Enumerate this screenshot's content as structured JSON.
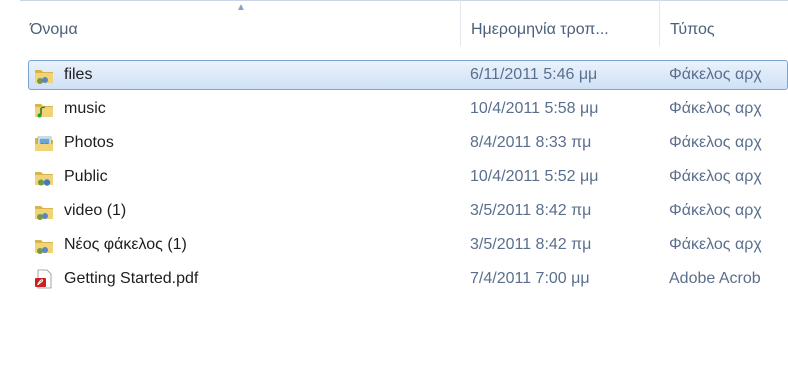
{
  "columns": {
    "name": "Όνομα",
    "date": "Ημερομηνία τροπ...",
    "type": "Τύπος"
  },
  "rows": [
    {
      "name": "files",
      "date": "6/11/2011 5:46 μμ",
      "type": "Φάκελος αρχ",
      "icon": "shared-folder-icon",
      "selected": true
    },
    {
      "name": "music",
      "date": "10/4/2011 5:58 μμ",
      "type": "Φάκελος αρχ",
      "icon": "music-folder-icon",
      "selected": false
    },
    {
      "name": "Photos",
      "date": "8/4/2011 8:33 πμ",
      "type": "Φάκελος αρχ",
      "icon": "pictures-folder-icon",
      "selected": false
    },
    {
      "name": "Public",
      "date": "10/4/2011 5:52 μμ",
      "type": "Φάκελος αρχ",
      "icon": "public-folder-icon",
      "selected": false
    },
    {
      "name": "video (1)",
      "date": "3/5/2011 8:42 πμ",
      "type": "Φάκελος αρχ",
      "icon": "shared-folder-icon",
      "selected": false
    },
    {
      "name": "Νέος φάκελος (1)",
      "date": "3/5/2011 8:42 πμ",
      "type": "Φάκελος αρχ",
      "icon": "shared-folder-icon",
      "selected": false
    },
    {
      "name": "Getting Started.pdf",
      "date": "7/4/2011 7:00 μμ",
      "type": "Adobe Acrob",
      "icon": "pdf-file-icon",
      "selected": false
    }
  ]
}
